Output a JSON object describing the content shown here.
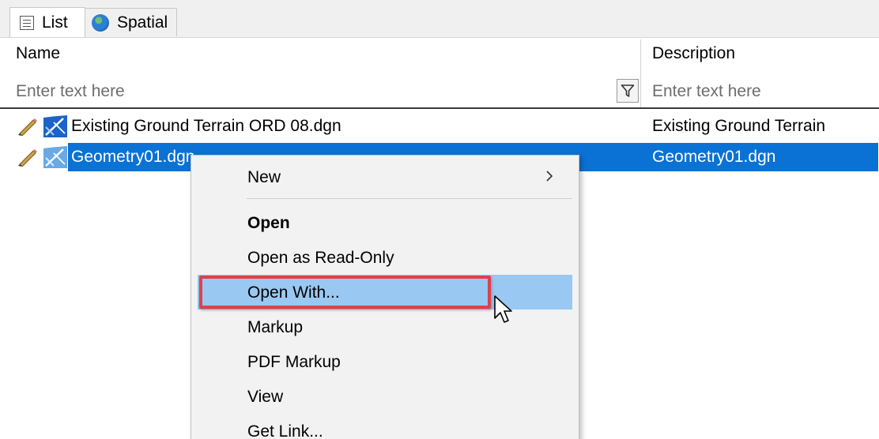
{
  "tabs": [
    {
      "label": "List",
      "icon": "list-view-icon",
      "active": true
    },
    {
      "label": "Spatial",
      "icon": "globe-icon",
      "active": false
    }
  ],
  "columns": {
    "name": {
      "header": "Name",
      "filter_placeholder": "Enter text here"
    },
    "description": {
      "header": "Description",
      "filter_placeholder": "Enter text here"
    }
  },
  "rows": [
    {
      "name": "Existing Ground Terrain ORD 08.dgn",
      "description": "Existing Ground Terrain",
      "selected": false
    },
    {
      "name": "Geometry01.dgn",
      "description": "Geometry01.dgn",
      "selected": true
    }
  ],
  "context_menu": {
    "items": [
      {
        "label": "New",
        "has_submenu": true
      },
      {
        "label": "Open",
        "bold": true
      },
      {
        "label": "Open as Read-Only"
      },
      {
        "label": "Open With...",
        "hovered": true,
        "highlighted": true
      },
      {
        "label": "Markup"
      },
      {
        "label": "PDF Markup"
      },
      {
        "label": "View"
      },
      {
        "label": "Get Link..."
      }
    ]
  },
  "colors": {
    "selection": "#0a72d4",
    "menu_hover": "#99c8f2",
    "highlight_border": "#e0404c"
  }
}
